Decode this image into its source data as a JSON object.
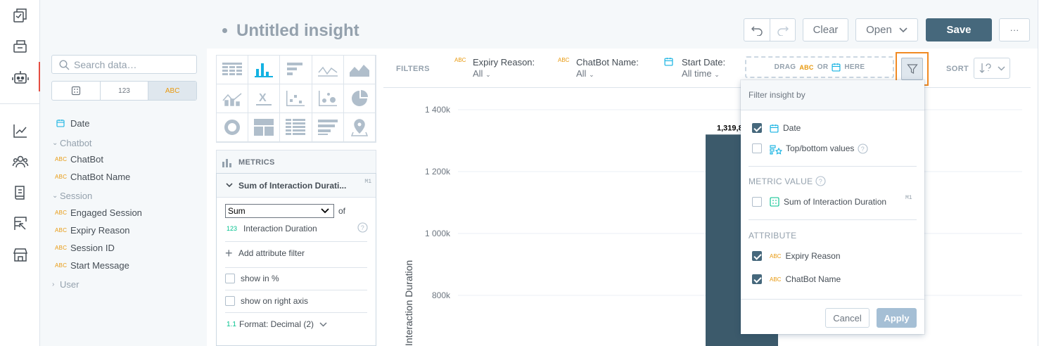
{
  "app_nav": {
    "items": [
      {
        "icon": "dashboards-icon"
      },
      {
        "icon": "analyze-icon"
      },
      {
        "icon": "chatbot-icon",
        "active": true
      },
      {
        "icon": "trends-icon"
      },
      {
        "icon": "users-icon"
      },
      {
        "icon": "reports-icon"
      },
      {
        "icon": "retention-icon"
      },
      {
        "icon": "store-icon"
      }
    ]
  },
  "header": {
    "title": "Untitled insight",
    "clear_label": "Clear",
    "open_label": "Open",
    "save_label": "Save",
    "more_label": "···"
  },
  "catalog": {
    "search_placeholder": "Search data…",
    "type_filters": [
      "",
      "123",
      "ABC"
    ],
    "date_label": "Date",
    "groups": [
      {
        "name": "Chatbot",
        "expanded": true,
        "items": [
          "ChatBot",
          "ChatBot Name"
        ]
      },
      {
        "name": "Session",
        "expanded": true,
        "items": [
          "Engaged Session",
          "Expiry Reason",
          "Session ID",
          "Start Message"
        ]
      },
      {
        "name": "User",
        "expanded": false,
        "items": []
      }
    ],
    "abc": "ABC"
  },
  "config": {
    "metrics_label": "METRICS",
    "metric": {
      "title": "Sum of Interaction Durati...",
      "tag": "M1",
      "aggregation": "Sum",
      "of_label": "of",
      "measure_type": "123",
      "measure": "Interaction Duration",
      "add_filter": "Add attribute filter",
      "show_percent": "show in %",
      "show_right_axis": "show on right axis",
      "format_type": "1.1",
      "format": "Format: Decimal (2)"
    }
  },
  "filterbar": {
    "label": "FILTERS",
    "filters": [
      {
        "type": "ABC",
        "name": "Expiry Reason:",
        "value": "All"
      },
      {
        "type": "ABC",
        "name": "ChatBot Name:",
        "value": "All"
      },
      {
        "type": "date",
        "name": "Start Date:",
        "value": "All time"
      }
    ],
    "drag_prefix": "DRAG",
    "drag_abc": "ABC",
    "drag_or": "OR",
    "drag_suffix": "HERE",
    "sort_label": "SORT"
  },
  "chart_data": {
    "type": "bar",
    "ylabel": "Interaction Duration",
    "y_ticks": [
      "1 400k",
      "1 200k",
      "1 000k",
      "800k"
    ],
    "tick_values": [
      1400000,
      1200000,
      1000000,
      800000
    ],
    "values": [
      1319800
    ],
    "data_label": "1,319,8",
    "color": "#3c5a6b"
  },
  "dropdown": {
    "title": "Filter insight by",
    "date_label": "Date",
    "date_checked": true,
    "topbottom_label": "Top/bottom values",
    "topbottom_checked": false,
    "metric_section": "METRIC VALUE",
    "metric_label": "Sum of Interaction Duration",
    "metric_tag": "M1",
    "metric_checked": false,
    "attribute_section": "ATTRIBUTE",
    "attributes": [
      {
        "label": "Expiry Reason",
        "checked": true
      },
      {
        "label": "ChatBot Name",
        "checked": true
      }
    ],
    "abc": "ABC",
    "cancel_label": "Cancel",
    "apply_label": "Apply"
  }
}
